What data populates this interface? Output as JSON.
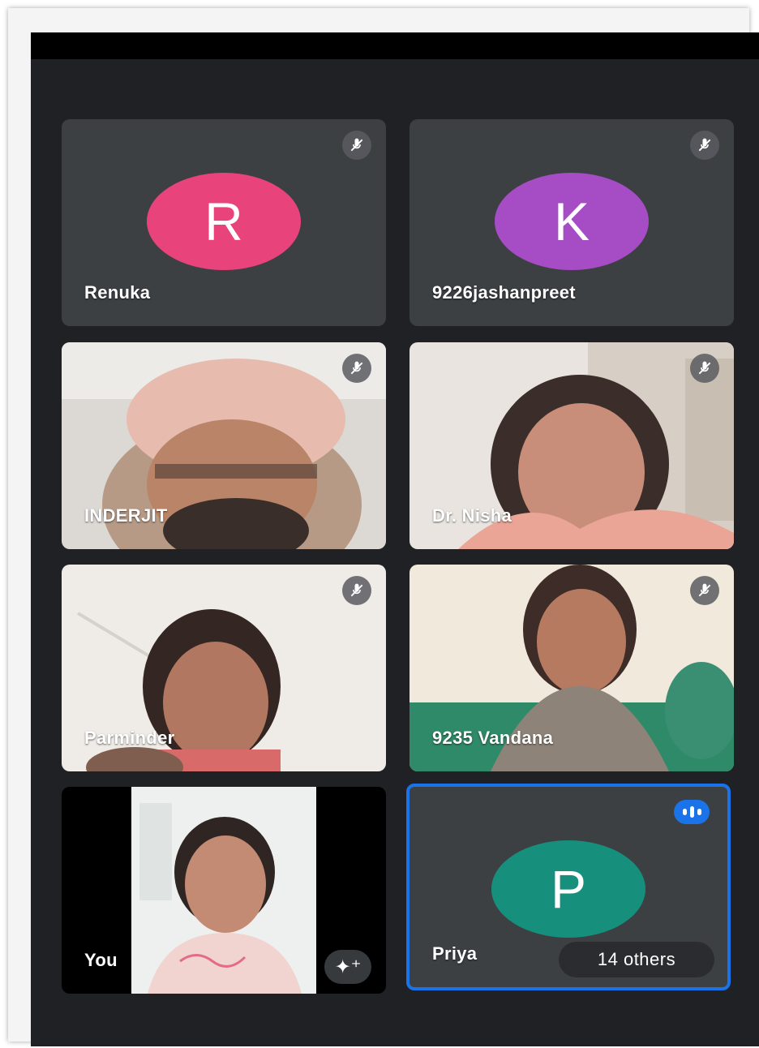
{
  "meeting": {
    "tiles": [
      {
        "name": "Renuka",
        "initial": "R",
        "avatar_color": "#e8437a",
        "muted": true
      },
      {
        "name": "9226jashanpreet",
        "initial": "K",
        "avatar_color": "#a64cc4",
        "muted": true
      },
      {
        "name": "INDERJIT",
        "muted": true
      },
      {
        "name": "Dr. Nisha",
        "muted": true
      },
      {
        "name": "Parminder",
        "muted": true
      },
      {
        "name": "9235 Vandana",
        "muted": true
      },
      {
        "name": "You",
        "effects_icon": "sparkle-icon"
      },
      {
        "name": "Priya",
        "initial": "P",
        "avatar_color": "#168f7c",
        "speaking": true,
        "others_label": "14 others"
      }
    ],
    "accent_color": "#1a73e8",
    "background_color": "#202124"
  }
}
